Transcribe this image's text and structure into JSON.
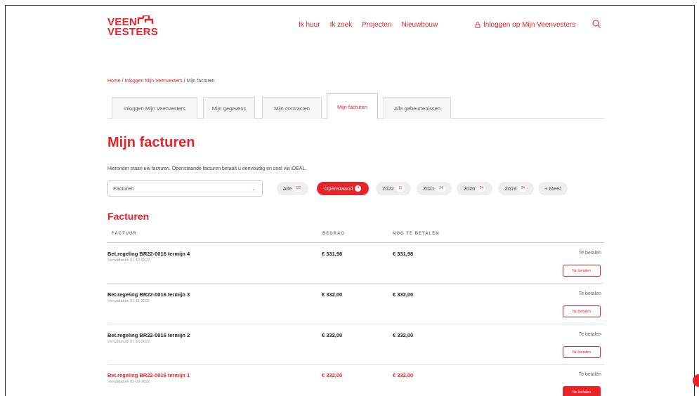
{
  "brand": {
    "line1": "VEEN",
    "line2": "VESTERS",
    "accent": "#e8232a"
  },
  "nav": {
    "items": [
      "Ik huur",
      "Ik zoek",
      "Projecten",
      "Nieuwbouw"
    ],
    "login": "Inloggen op Mijn Veenvesters"
  },
  "breadcrumb": {
    "home": "Home",
    "sep1": " / ",
    "parent": "Inloggen Mijn Veenvesters",
    "sep2": " / ",
    "current": "Mijn facturen"
  },
  "tabs": [
    "Inloggen Mijn Veenvesters",
    "Mijn gegevens",
    "Mijn contracten",
    "Mijn facturen",
    "Alle gebeurtenissen"
  ],
  "page": {
    "title": "Mijn facturen",
    "intro": "Hieronder staan uw facturen. Openstaande facturen betaalt u eenvoudig en snel via iDEAL.",
    "select_value": "Facturen"
  },
  "filters": [
    {
      "label": "Alle",
      "count": "122"
    },
    {
      "label": "Openstaand",
      "count": "4"
    },
    {
      "label": "2022",
      "count": "11"
    },
    {
      "label": "2021",
      "count": "24"
    },
    {
      "label": "2020",
      "count": "24"
    },
    {
      "label": "2019",
      "count": "24"
    },
    {
      "label": "+ Meer",
      "count": ""
    }
  ],
  "section": {
    "title": "Facturen",
    "columns": [
      "FACTUUR",
      "BEDRAG",
      "NOG TE BETALEN"
    ]
  },
  "invoices": [
    {
      "name": "Bet.regeling BR22-0016 termijn 4",
      "due": "Vervaldatum 01-12-2022",
      "amount": "€ 331,98",
      "remaining": "€ 331,98",
      "status": "Te betalen",
      "button": "Nu betalen"
    },
    {
      "name": "Bet.regeling BR22-0016 termijn 3",
      "due": "Vervaldatum 01-11-2022",
      "amount": "€ 332,00",
      "remaining": "€ 332,00",
      "status": "Te betalen",
      "button": "Nu betalen"
    },
    {
      "name": "Bet.regeling BR22-0016 termijn 2",
      "due": "Vervaldatum 01-10-2022",
      "amount": "€ 332,00",
      "remaining": "€ 332,00",
      "status": "Te betalen",
      "button": "Nu betalen"
    },
    {
      "name": "Bet.regeling BR22-0016 termijn 1",
      "due": "Vervaldatum 01-09-2022",
      "amount": "€ 332,00",
      "remaining": "€ 332,00",
      "status": "Te betalen",
      "button": "Nu betalen"
    }
  ]
}
